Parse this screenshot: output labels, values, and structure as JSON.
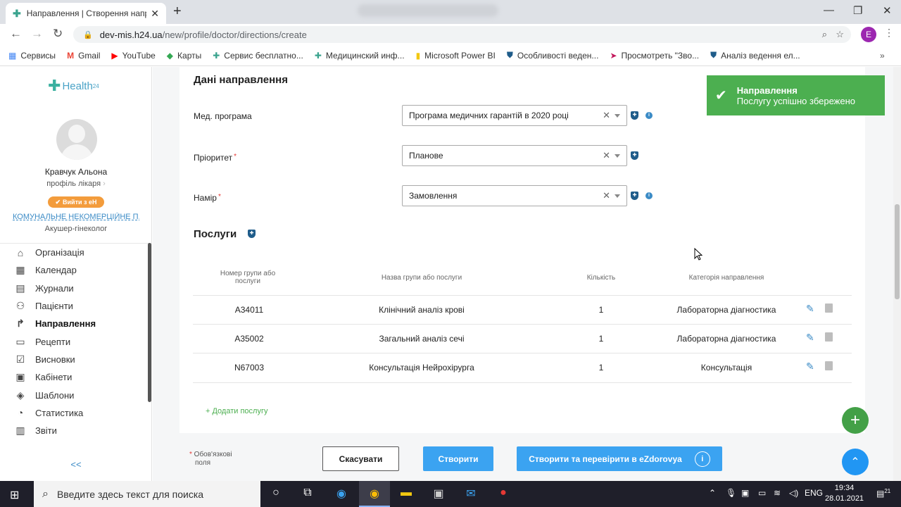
{
  "browser": {
    "tab_title": "Направлення | Створення напр",
    "url_domain": "dev-mis.h24.ua",
    "url_path": "/new/profile/doctor/directions/create",
    "profile_initial": "E",
    "bookmarks": [
      {
        "label": "Сервисы",
        "icon": "apps-grid-icon"
      },
      {
        "label": "Gmail",
        "icon": "gmail-icon"
      },
      {
        "label": "YouTube",
        "icon": "youtube-icon"
      },
      {
        "label": "Карты",
        "icon": "maps-icon"
      },
      {
        "label": "Сервис бесплатно...",
        "icon": "puzzle-icon"
      },
      {
        "label": "Медицинский инф...",
        "icon": "puzzle-icon"
      },
      {
        "label": "Microsoft Power BI",
        "icon": "powerbi-icon"
      },
      {
        "label": "Особливості веден...",
        "icon": "shield-icon"
      },
      {
        "label": "Просмотреть \"Зво...",
        "icon": "arrow-icon"
      },
      {
        "label": "Аналіз ведення ел...",
        "icon": "shield-icon"
      }
    ]
  },
  "sidebar": {
    "logo_text": "Health",
    "logo_sup": "24",
    "doctor_name": "Кравчук Альона",
    "profile_link": "профіль лікаря",
    "exit_button": "Вийти з еН",
    "org_name": "КОМУНАЛЬНЕ НЕКОМЕРЦІЙНЕ П...",
    "specialty": "Акушер-гінеколог",
    "menu": [
      {
        "label": "Організація",
        "icon": "home-icon"
      },
      {
        "label": "Календар",
        "icon": "calendar-icon"
      },
      {
        "label": "Журнали",
        "icon": "journal-icon"
      },
      {
        "label": "Пацієнти",
        "icon": "patients-icon"
      },
      {
        "label": "Направлення",
        "icon": "directions-icon",
        "active": true
      },
      {
        "label": "Рецепти",
        "icon": "recipe-icon"
      },
      {
        "label": "Висновки",
        "icon": "conclusion-icon"
      },
      {
        "label": "Кабінети",
        "icon": "cabinet-icon"
      },
      {
        "label": "Шаблони",
        "icon": "layers-icon"
      },
      {
        "label": "Статистика",
        "icon": "stats-icon"
      },
      {
        "label": "Звіти",
        "icon": "reports-icon"
      }
    ],
    "collapse_label": "<<"
  },
  "form": {
    "section_title": "Дані направлення",
    "fields": [
      {
        "label": "Мед. програма",
        "required": false,
        "value": "Програма медичних гарантій в 2020 році",
        "info": true
      },
      {
        "label": "Пріоритет",
        "required": true,
        "value": "Планове",
        "info": false
      },
      {
        "label": "Намір",
        "required": true,
        "value": "Замовлення",
        "info": true
      }
    ],
    "required_mark": "*"
  },
  "services": {
    "title": "Послуги",
    "headers": {
      "code_line1": "Номер групи або",
      "code_line2": "послуги",
      "name": "Назва групи або послуги",
      "qty": "Кількість",
      "category": "Категорія направлення"
    },
    "rows": [
      {
        "code": "A34011",
        "name": "Клінічний аналіз крові",
        "qty": "1",
        "category": "Лабораторна діагностика"
      },
      {
        "code": "A35002",
        "name": "Загальний аналіз сечі",
        "qty": "1",
        "category": "Лабораторна діагностика"
      },
      {
        "code": "N67003",
        "name": "Консультація Нейрохірурга",
        "qty": "1",
        "category": "Консультація"
      }
    ],
    "add_label": "+ Додати послугу"
  },
  "footer": {
    "required_note_line1": "Обов'язкові",
    "required_note_line2": "поля",
    "cancel_label": "Скасувати",
    "create_label": "Створити",
    "create_check_label": "Створити та перевірити в eZdorovya"
  },
  "toast": {
    "title": "Направлення",
    "message": "Послугу успішно збережено"
  },
  "taskbar": {
    "search_placeholder": "Введите здесь текст для поиска",
    "lang": "ENG",
    "time": "19:34",
    "date": "28.01.2021",
    "notif_count": "21"
  },
  "colors": {
    "accent_blue": "#3ba3f1",
    "success_green": "#4caf50",
    "required_red": "#e53935"
  }
}
